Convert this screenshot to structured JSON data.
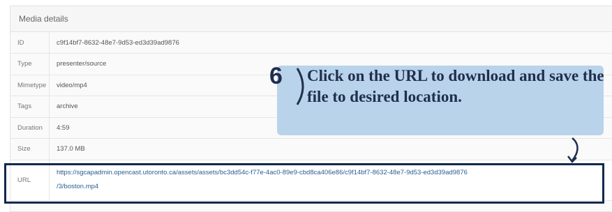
{
  "panel": {
    "title": "Media details"
  },
  "rows": [
    {
      "key": "ID",
      "value": "c9f14bf7-8632-48e7-9d53-ed3d39ad9876"
    },
    {
      "key": "Type",
      "value": "presenter/source"
    },
    {
      "key": "Mimetype",
      "value": "video/mp4"
    },
    {
      "key": "Tags",
      "value": "archive"
    },
    {
      "key": "Duration",
      "value": "4:59"
    },
    {
      "key": "Size",
      "value": "137.0 MB"
    }
  ],
  "url_row": {
    "key": "URL",
    "line1": "https://sgcapadmin.opencast.utoronto.ca/assets/assets/bc3dd54c-f77e-4ac0-89e9-cbd8ca406e86/c9f14bf7-8632-48e7-9d53-ed3d39ad9876",
    "line2": "/3/boston.mp4"
  },
  "callout": {
    "step": "6",
    "text": "Click on the URL to download and save the file to desired location."
  },
  "colors": {
    "highlight_border": "#11284f",
    "callout_bg": "#b9d3ea",
    "callout_text": "#1f2f4d",
    "link": "#2a5d91"
  }
}
